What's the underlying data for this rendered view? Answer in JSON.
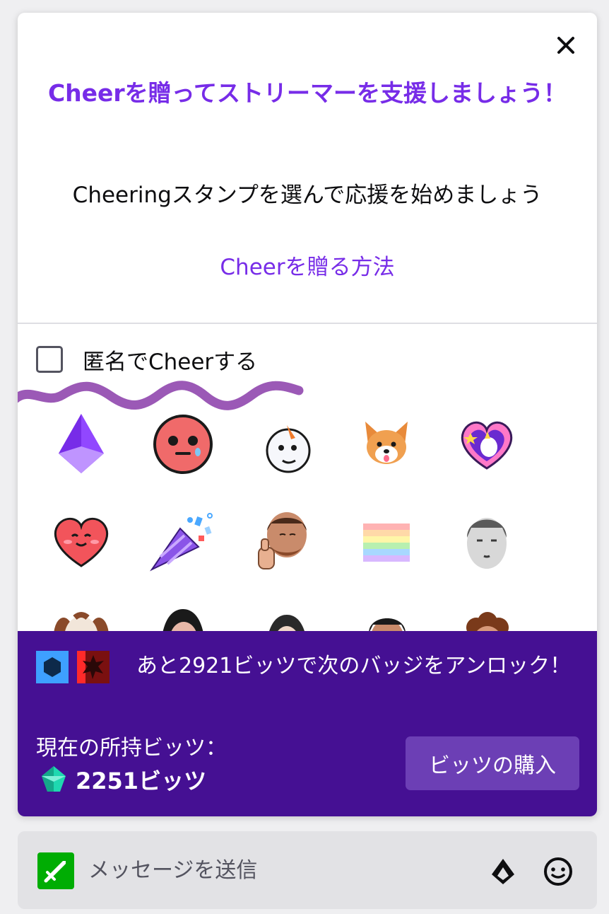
{
  "popup": {
    "title": "Cheerを贈ってストリーマーを支援しましょう！",
    "subtitle": "Cheeringスタンプを選んで応援を始めましょう",
    "howto_link": "Cheerを贈る方法",
    "anonymous_label": "匿名でCheerする",
    "anonymous_checked": false
  },
  "emotes": [
    {
      "name": "cheer-gem-icon"
    },
    {
      "name": "sad-face-icon"
    },
    {
      "name": "snowman-icon"
    },
    {
      "name": "corgi-icon"
    },
    {
      "name": "unicorn-heart-icon"
    },
    {
      "name": "smiling-heart-icon"
    },
    {
      "name": "party-popper-icon"
    },
    {
      "name": "thumbs-up-streamer-icon"
    },
    {
      "name": "rainbow-flag-icon"
    },
    {
      "name": "streamer-face-icon"
    },
    {
      "name": "dog-emote-icon"
    },
    {
      "name": "woman-emote-icon"
    },
    {
      "name": "hooded-emote-icon"
    },
    {
      "name": "man-emote-icon"
    },
    {
      "name": "curly-hair-emote-icon"
    }
  ],
  "bits_panel": {
    "unlock_message": "あと2921ビッツで次のバッジをアンロック！",
    "current_label": "現在の所持ビッツ：",
    "balance": "2251ビッツ",
    "buy_button": "ビッツの購入"
  },
  "chat": {
    "placeholder": "メッセージを送信"
  },
  "colors": {
    "accent": "#772ce8",
    "panel": "#451093",
    "buy_button": "#6c3fb5",
    "badge_green": "#00ad03",
    "annotation": "#9b59b6"
  }
}
